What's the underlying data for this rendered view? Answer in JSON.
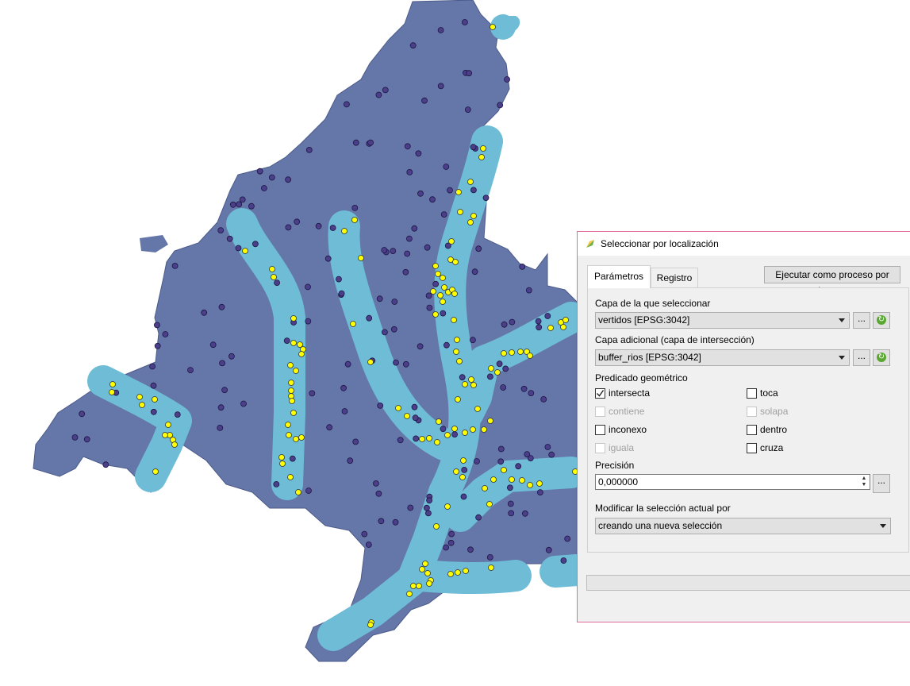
{
  "map": {
    "colors": {
      "region": "#6477a8",
      "buffer": "#6fbcd6",
      "inside_point": "#ffff00",
      "outside_point": "#4b3e8a"
    }
  },
  "dialog": {
    "title": "Seleccionar por localización",
    "tabs": [
      {
        "label": "Parámetros",
        "active": true
      },
      {
        "label": "Registro",
        "active": false
      }
    ],
    "run_batch_label": "Ejecutar como proceso por lotes...",
    "select_from_label": "Capa de la que seleccionar",
    "select_from_value": "vertidos [EPSG:3042]",
    "additional_label": "Capa adicional (capa de intersección)",
    "additional_value": "buffer_rios [EPSG:3042]",
    "browse_label": "...",
    "predicate_label": "Predicado geométrico",
    "predicates": {
      "intersecta": {
        "label": "intersecta",
        "checked": true,
        "enabled": true
      },
      "toca": {
        "label": "toca",
        "checked": false,
        "enabled": true
      },
      "contiene": {
        "label": "contiene",
        "checked": false,
        "enabled": false
      },
      "solapa": {
        "label": "solapa",
        "checked": false,
        "enabled": false
      },
      "inconexo": {
        "label": "inconexo",
        "checked": false,
        "enabled": true
      },
      "dentro": {
        "label": "dentro",
        "checked": false,
        "enabled": true
      },
      "iguala": {
        "label": "iguala",
        "checked": false,
        "enabled": false
      },
      "cruza": {
        "label": "cruza",
        "checked": false,
        "enabled": true
      }
    },
    "precision_label": "Precisión",
    "precision_value": "0,000000",
    "modify_label": "Modificar la selección actual por",
    "modify_value": "creando una nueva selección",
    "progress": 0
  }
}
